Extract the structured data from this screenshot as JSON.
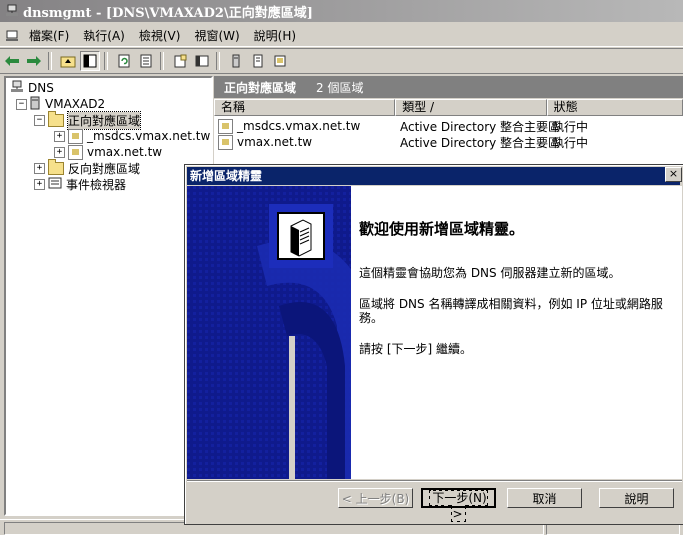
{
  "window": {
    "title": "dnsmgmt - [DNS\\VMAXAD2\\正向對應區域]"
  },
  "menubar": {
    "items": [
      "檔案(F)",
      "執行(A)",
      "檢視(V)",
      "視窗(W)",
      "說明(H)"
    ]
  },
  "toolbar": {
    "buttons": [
      "back-icon",
      "forward-icon",
      "up-folder-icon",
      "show-tree-icon",
      "refresh-icon",
      "export-list-icon",
      "properties-icon",
      "console-icon",
      "server-icon",
      "document-icon",
      "zone-icon"
    ]
  },
  "tree": {
    "root": "DNS",
    "server": "VMAXAD2",
    "forward": "正向對應區域",
    "zone1": "_msdcs.vmax.net.tw",
    "zone2": "vmax.net.tw",
    "reverse": "反向對應區域",
    "events": "事件檢視器"
  },
  "right_header": {
    "title": "正向對應區域",
    "count": "2 個區域"
  },
  "list": {
    "columns": [
      "名稱",
      "類型 /",
      "狀態"
    ],
    "rows": [
      {
        "name": "_msdcs.vmax.net.tw",
        "type": "Active Directory 整合主要區",
        "status": "執行中"
      },
      {
        "name": "vmax.net.tw",
        "type": "Active Directory 整合主要區",
        "status": "執行中"
      }
    ]
  },
  "wizard": {
    "title": "新增區域精靈",
    "close": "×",
    "heading": "歡迎使用新增區域精靈。",
    "para1": "這個精靈會協助您為 DNS 伺服器建立新的區域。",
    "para2": "區域將 DNS 名稱轉譯成相關資料，例如 IP 位址或網路服務。",
    "para3": "請按 [下一步] 繼續。",
    "buttons": {
      "back": "< 上一步(B)",
      "next": "下一步(N) >",
      "cancel": "取消",
      "help": "說明"
    }
  }
}
